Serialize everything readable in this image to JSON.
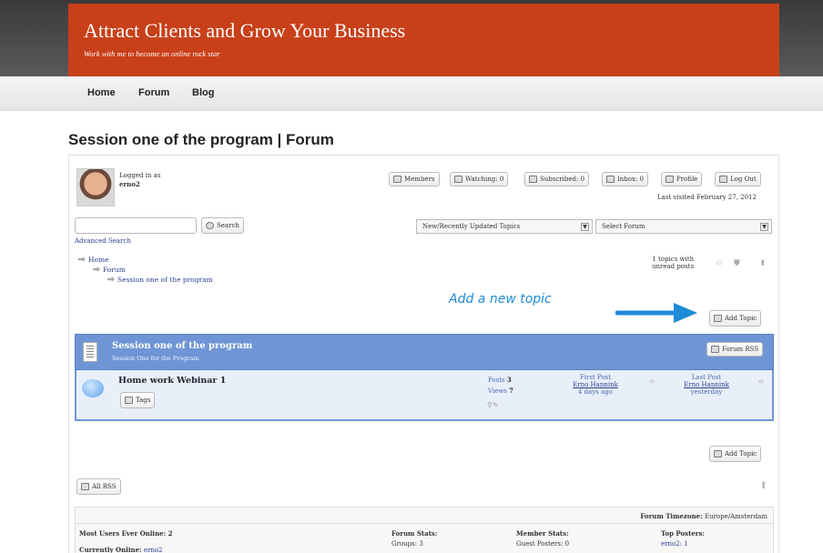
{
  "header": {
    "title": "Attract Clients and Grow Your Business",
    "tagline": "Work with me to become an online rock star"
  },
  "nav": {
    "items": [
      "Home",
      "Forum",
      "Blog"
    ]
  },
  "page": {
    "title": "Session one of the program | Forum"
  },
  "user": {
    "logged_in_label": "Logged in as",
    "username": "erno2",
    "last_visited": "Last visited February 27, 2012"
  },
  "toolbar": {
    "members": "Members",
    "watching": "Watching: 0",
    "subscribed": "Subscribed: 0",
    "inbox": "Inbox: 0",
    "profile": "Profile",
    "logout": "Log Out"
  },
  "search": {
    "button": "Search",
    "advanced": "Advanced Search"
  },
  "filters": {
    "topics_select": "New/Recently Updated Topics",
    "forum_select": "Select Forum"
  },
  "breadcrumb": [
    "Home",
    "Forum",
    "Session one of the program"
  ],
  "unread": {
    "line1": "1 topics with",
    "line2": "unread posts"
  },
  "annotation": "Add a new topic",
  "add_topic": "Add Topic",
  "forum": {
    "name": "Session one of the program",
    "description": "Session One for the Program",
    "rss": "Forum RSS"
  },
  "topic": {
    "title": "Home work Webinar 1",
    "tags": "Tags",
    "posts_label": "Posts",
    "posts": "3",
    "views_label": "Views",
    "views": "7",
    "first_post_label": "First Post",
    "first_post_author": "Erno Hannink",
    "first_post_time": "4 days ago",
    "last_post_label": "Last Post",
    "last_post_author": "Erno Hannink",
    "last_post_time": "yesterday"
  },
  "all_rss": "All RSS",
  "stats": {
    "timezone_label": "Forum Timezone:",
    "timezone": "Europe/Amsterdam",
    "most_users": "Most Users Ever Online: 2",
    "currently_online_label": "Currently Online:",
    "currently_online": "erno2",
    "forum_stats": "Forum Stats:",
    "groups": "Groups: 3",
    "member_stats": "Member Stats:",
    "guest_posters": "Guest Posters: 0",
    "top_posters": "Top Posters:",
    "top_poster": "erno2: 1"
  },
  "colors": {
    "header": "#c8401a",
    "forum_head": "#6f95d6",
    "annotation": "#1e8bd6"
  }
}
